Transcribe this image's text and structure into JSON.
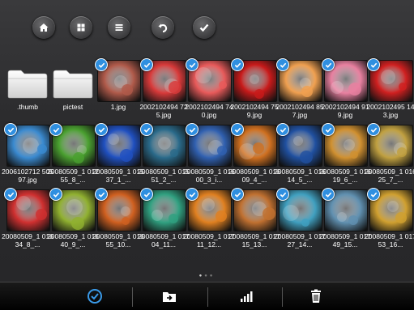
{
  "toolbar": {
    "buttons": [
      {
        "name": "home-button",
        "icon": "home-icon"
      },
      {
        "name": "grid-view-button",
        "icon": "grid-icon"
      },
      {
        "name": "list-view-button",
        "icon": "list-icon"
      },
      {
        "name": "back-button",
        "icon": "undo-icon"
      },
      {
        "name": "select-button",
        "icon": "check-icon"
      }
    ]
  },
  "items": [
    {
      "label": ".thumb",
      "type": "folder",
      "checked": false
    },
    {
      "label": "pictest",
      "type": "folder",
      "checked": false
    },
    {
      "label": "1.jpg",
      "type": "image",
      "checked": true,
      "color": "#b05a4a"
    },
    {
      "label": "2002102494 725.jpg",
      "type": "image",
      "checked": true,
      "color": "#d83a3a"
    },
    {
      "label": "2002102494 740.jpg",
      "type": "image",
      "checked": true,
      "color": "#e85a5a"
    },
    {
      "label": "2002102494 759.jpg",
      "type": "image",
      "checked": true,
      "color": "#c81a1a"
    },
    {
      "label": "2002102494 857.jpg",
      "type": "image",
      "checked": true,
      "color": "#f0a050"
    },
    {
      "label": "2002102494 919.jpg",
      "type": "image",
      "checked": true,
      "color": "#e880a0"
    },
    {
      "label": "2002102495 143.jpg",
      "type": "image",
      "checked": true,
      "color": "#d02020"
    },
    {
      "label": "2006102712 50597.jpg",
      "type": "image",
      "checked": true,
      "color": "#3a8ad0"
    },
    {
      "label": "20080509_1 01255_8_...",
      "type": "image",
      "checked": true,
      "color": "#4aa030"
    },
    {
      "label": "20080509_1 01537_1_...",
      "type": "image",
      "checked": true,
      "color": "#2050c0"
    },
    {
      "label": "20080509_1 01551_2_...",
      "type": "image",
      "checked": true,
      "color": "#2a6a8a"
    },
    {
      "label": "20080509_1 01600_3_i...",
      "type": "image",
      "checked": true,
      "color": "#3060b0"
    },
    {
      "label": "20080509_1 01609_4_...",
      "type": "image",
      "checked": true,
      "color": "#d07020"
    },
    {
      "label": "20080509_1 01614_5_...",
      "type": "image",
      "checked": true,
      "color": "#2050a0"
    },
    {
      "label": "20080509_1 01619_6_...",
      "type": "image",
      "checked": true,
      "color": "#d09030"
    },
    {
      "label": "20080509_1 01625_7_...",
      "type": "image",
      "checked": true,
      "color": "#c0a040"
    },
    {
      "label": "20080509_1 01634_8_...",
      "type": "image",
      "checked": true,
      "color": "#d03030"
    },
    {
      "label": "20080509_1 01640_9_...",
      "type": "image",
      "checked": true,
      "color": "#90b030"
    },
    {
      "label": "20080509_1 01655_10...",
      "type": "image",
      "checked": true,
      "color": "#d06020"
    },
    {
      "label": "20080509_1 01704_11...",
      "type": "image",
      "checked": true,
      "color": "#30a080"
    },
    {
      "label": "20080509_1 01711_12...",
      "type": "image",
      "checked": true,
      "color": "#e08020"
    },
    {
      "label": "20080509_1 01715_13...",
      "type": "image",
      "checked": true,
      "color": "#c07030"
    },
    {
      "label": "20080509_1 01727_14...",
      "type": "image",
      "checked": true,
      "color": "#40a0c0"
    },
    {
      "label": "20080509_1 01749_15...",
      "type": "image",
      "checked": true,
      "color": "#6090b0"
    },
    {
      "label": "20080509_1 01753_16...",
      "type": "image",
      "checked": true,
      "color": "#d0a030"
    }
  ],
  "pagination": {
    "pages": 3,
    "current": 1
  },
  "bottombar": {
    "buttons": [
      {
        "name": "select-all-button",
        "icon": "check-circle-icon"
      },
      {
        "name": "move-to-folder-button",
        "icon": "folder-move-icon"
      },
      {
        "name": "sort-button",
        "icon": "bar-chart-icon"
      },
      {
        "name": "delete-button",
        "icon": "trash-icon"
      }
    ]
  }
}
